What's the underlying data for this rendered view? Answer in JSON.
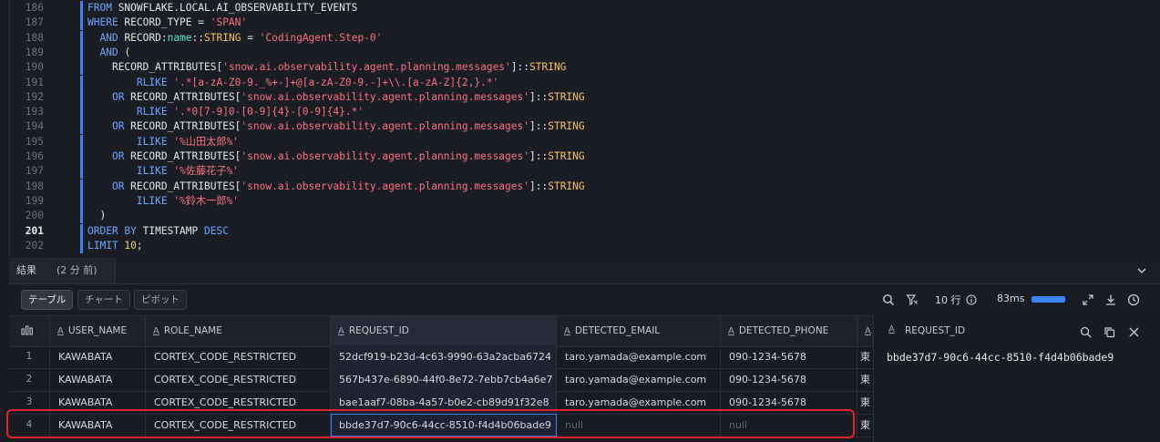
{
  "editor": {
    "lines": [
      {
        "num": "186",
        "indent": "",
        "tokens": [
          {
            "t": "FROM ",
            "c": "kw"
          },
          {
            "t": "SNOWFLAKE.LOCAL.AI_OBSERVABILITY_EVENTS",
            "c": "id"
          }
        ]
      },
      {
        "num": "187",
        "indent": "",
        "tokens": [
          {
            "t": "WHERE ",
            "c": "kw"
          },
          {
            "t": "RECORD_TYPE = ",
            "c": "id"
          },
          {
            "t": "'SPAN'",
            "c": "str"
          }
        ]
      },
      {
        "num": "188",
        "indent": "  ",
        "tokens": [
          {
            "t": "AND ",
            "c": "kw"
          },
          {
            "t": "RECORD:",
            "c": "id"
          },
          {
            "t": "name",
            "c": "fn"
          },
          {
            "t": "::",
            "c": "id"
          },
          {
            "t": "STRING",
            "c": "typ"
          },
          {
            "t": " = ",
            "c": "id"
          },
          {
            "t": "'CodingAgent.Step-0'",
            "c": "str"
          }
        ]
      },
      {
        "num": "189",
        "indent": "  ",
        "tokens": [
          {
            "t": "AND ",
            "c": "kw"
          },
          {
            "t": "(",
            "c": "id"
          }
        ]
      },
      {
        "num": "190",
        "indent": "    ",
        "tokens": [
          {
            "t": "RECORD_ATTRIBUTES[",
            "c": "id"
          },
          {
            "t": "'snow.ai.observability.agent.planning.messages'",
            "c": "str"
          },
          {
            "t": "]::",
            "c": "id"
          },
          {
            "t": "STRING",
            "c": "typ"
          }
        ]
      },
      {
        "num": "191",
        "indent": "        ",
        "tokens": [
          {
            "t": "RLIKE ",
            "c": "kw"
          },
          {
            "t": "'.*[a-zA-Z0-9._%+-]+@[a-zA-Z0-9.-]+\\\\.[a-zA-Z]{2,}.*'",
            "c": "str"
          }
        ]
      },
      {
        "num": "192",
        "indent": "    ",
        "tokens": [
          {
            "t": "OR ",
            "c": "kw"
          },
          {
            "t": "RECORD_ATTRIBUTES[",
            "c": "id"
          },
          {
            "t": "'snow.ai.observability.agent.planning.messages'",
            "c": "str"
          },
          {
            "t": "]::",
            "c": "id"
          },
          {
            "t": "STRING",
            "c": "typ"
          }
        ]
      },
      {
        "num": "193",
        "indent": "        ",
        "tokens": [
          {
            "t": "RLIKE ",
            "c": "kw"
          },
          {
            "t": "'.*0[7-9]0-[0-9]{4}-[0-9]{4}.*'",
            "c": "str"
          }
        ]
      },
      {
        "num": "194",
        "indent": "    ",
        "tokens": [
          {
            "t": "OR ",
            "c": "kw"
          },
          {
            "t": "RECORD_ATTRIBUTES[",
            "c": "id"
          },
          {
            "t": "'snow.ai.observability.agent.planning.messages'",
            "c": "str"
          },
          {
            "t": "]::",
            "c": "id"
          },
          {
            "t": "STRING",
            "c": "typ"
          }
        ]
      },
      {
        "num": "195",
        "indent": "        ",
        "tokens": [
          {
            "t": "ILIKE ",
            "c": "kw"
          },
          {
            "t": "'%山田太郎%'",
            "c": "str"
          }
        ]
      },
      {
        "num": "196",
        "indent": "    ",
        "tokens": [
          {
            "t": "OR ",
            "c": "kw"
          },
          {
            "t": "RECORD_ATTRIBUTES[",
            "c": "id"
          },
          {
            "t": "'snow.ai.observability.agent.planning.messages'",
            "c": "str"
          },
          {
            "t": "]::",
            "c": "id"
          },
          {
            "t": "STRING",
            "c": "typ"
          }
        ]
      },
      {
        "num": "197",
        "indent": "        ",
        "tokens": [
          {
            "t": "ILIKE ",
            "c": "kw"
          },
          {
            "t": "'%佐藤花子%'",
            "c": "str"
          }
        ]
      },
      {
        "num": "198",
        "indent": "    ",
        "tokens": [
          {
            "t": "OR ",
            "c": "kw"
          },
          {
            "t": "RECORD_ATTRIBUTES[",
            "c": "id"
          },
          {
            "t": "'snow.ai.observability.agent.planning.messages'",
            "c": "str"
          },
          {
            "t": "]::",
            "c": "id"
          },
          {
            "t": "STRING",
            "c": "typ"
          }
        ]
      },
      {
        "num": "199",
        "indent": "        ",
        "tokens": [
          {
            "t": "ILIKE ",
            "c": "kw"
          },
          {
            "t": "'%鈴木一郎%'",
            "c": "str"
          }
        ]
      },
      {
        "num": "200",
        "indent": "  ",
        "tokens": [
          {
            "t": ")",
            "c": "id"
          }
        ]
      },
      {
        "num": "201",
        "indent": "",
        "active": true,
        "tokens": [
          {
            "t": "ORDER BY ",
            "c": "kw"
          },
          {
            "t": "TIMESTAMP ",
            "c": "id"
          },
          {
            "t": "DESC",
            "c": "kw"
          }
        ]
      },
      {
        "num": "202",
        "indent": "",
        "tokens": [
          {
            "t": "LIMIT ",
            "c": "kw"
          },
          {
            "t": "10",
            "c": "num"
          },
          {
            "t": ";",
            "c": "id"
          }
        ]
      }
    ]
  },
  "results": {
    "tab_label": "結果",
    "age": "(2 分 前)",
    "views": [
      "テーブル",
      "チャート",
      "ピボット"
    ],
    "selected_view": "テーブル",
    "row_count": "10 行",
    "duration": "83ms",
    "accent": "#3b82f6"
  },
  "table": {
    "columns": [
      "USER_NAME",
      "ROLE_NAME",
      "REQUEST_ID",
      "DETECTED_EMAIL",
      "DETECTED_PHONE"
    ],
    "rows": [
      {
        "idx": "1",
        "cells": [
          "KAWABATA",
          "CORTEX_CODE_RESTRICTED",
          "52dcf919-b23d-4c63-9990-63a2acba6724",
          "taro.yamada@example.com",
          "090-1234-5678"
        ],
        "extra": "東"
      },
      {
        "idx": "2",
        "cells": [
          "KAWABATA",
          "CORTEX_CODE_RESTRICTED",
          "567b437e-6890-44f0-8e72-7ebb7cb4a6e7",
          "taro.yamada@example.com",
          "090-1234-5678"
        ],
        "extra": "東"
      },
      {
        "idx": "3",
        "cells": [
          "KAWABATA",
          "CORTEX_CODE_RESTRICTED",
          "bae1aaf7-08ba-4a57-b0e2-cb89d91f32e8",
          "taro.yamada@example.com",
          "090-1234-5678"
        ],
        "extra": "東"
      },
      {
        "idx": "4",
        "cells": [
          "KAWABATA",
          "CORTEX_CODE_RESTRICTED",
          "bbde37d7-90c6-44cc-8510-f4d4b06bade9",
          "null",
          "null"
        ],
        "extra": "東"
      }
    ],
    "highlight_color": "#e0242f"
  },
  "detail": {
    "title": "REQUEST_ID",
    "value": "bbde37d7-90c6-44cc-8510-f4d4b06bade9"
  }
}
